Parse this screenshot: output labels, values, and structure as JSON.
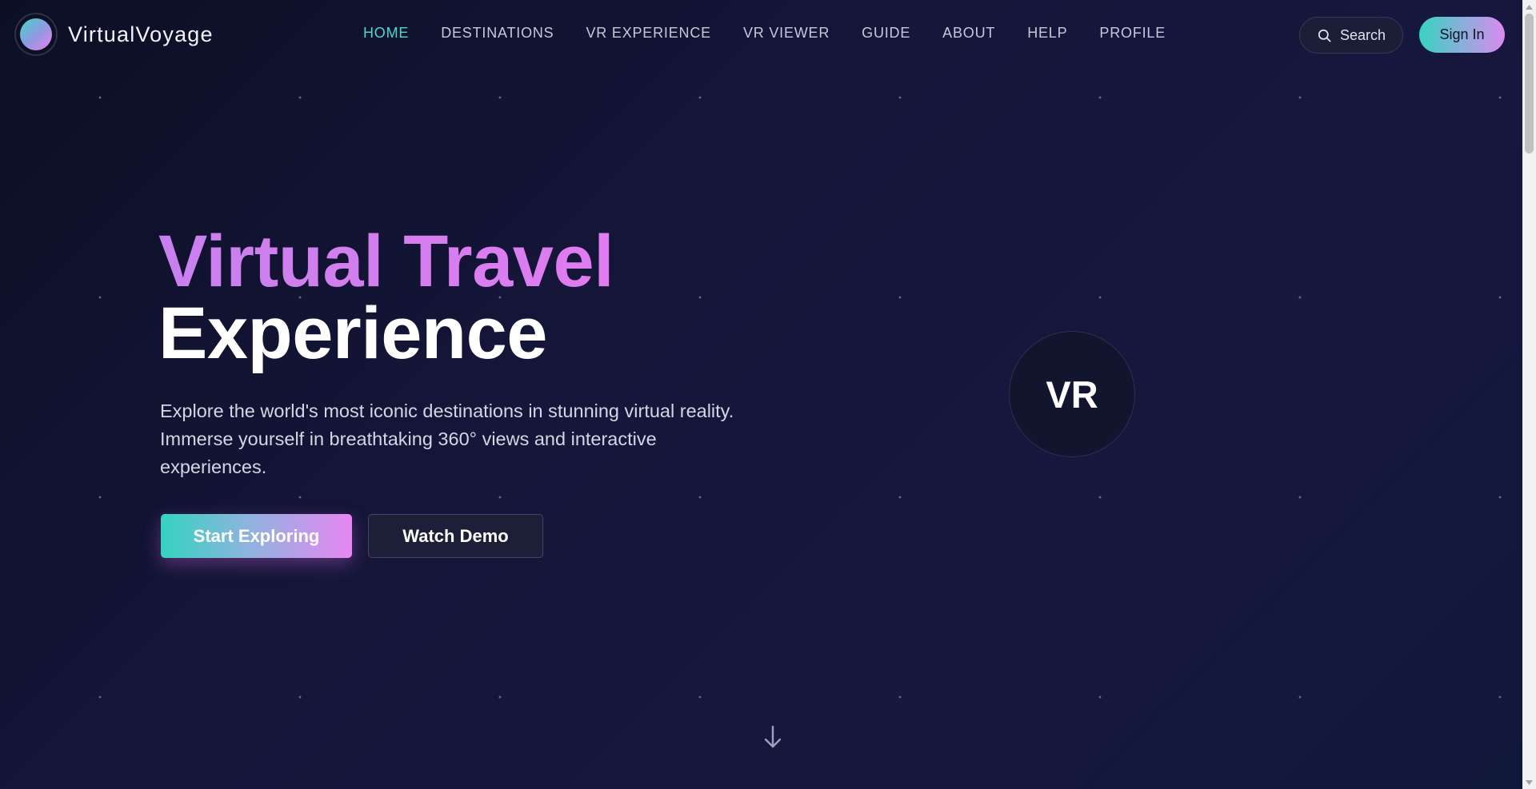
{
  "brand": {
    "name": "VirtualVoyage",
    "logo_icon": "gradient-orb-icon"
  },
  "nav": {
    "items": [
      {
        "label": "HOME",
        "active": true
      },
      {
        "label": "DESTINATIONS"
      },
      {
        "label": "VR EXPERIENCE"
      },
      {
        "label": "VR VIEWER"
      },
      {
        "label": "GUIDE"
      },
      {
        "label": "ABOUT"
      },
      {
        "label": "HELP"
      },
      {
        "label": "PROFILE"
      }
    ]
  },
  "header": {
    "search_label": "Search",
    "search_icon": "search-icon",
    "signin_label": "Sign In"
  },
  "hero": {
    "title_line1": "Virtual Travel",
    "title_line2": "Experience",
    "description": "Explore the world's most iconic destinations in stunning virtual reality. Immerse yourself in breathtaking 360° views and interactive experiences.",
    "primary_cta": "Start Exploring",
    "secondary_cta": "Watch Demo",
    "badge_text": "VR",
    "scroll_icon": "arrow-down-icon"
  },
  "colors": {
    "accent_teal": "#4dd8cc",
    "accent_pink": "#e07cf0",
    "background": "#15163a"
  }
}
